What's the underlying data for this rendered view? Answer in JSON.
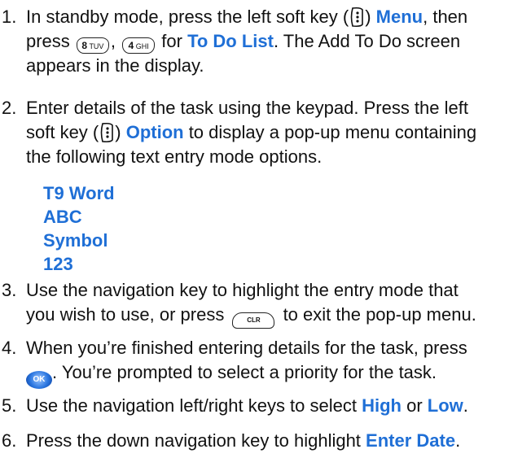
{
  "steps": [
    {
      "n": "1.",
      "l1": {
        "a": "In standby mode, press the left soft key (",
        "b": ") ",
        "menu": "Menu",
        "c": ", then"
      },
      "l2": {
        "a": "press ",
        "sep": ", ",
        "b": " for ",
        "todo": "To Do List",
        "c": ". The Add To Do screen"
      },
      "l3": "appears in the display."
    },
    {
      "n": "2.",
      "l1": "Enter details of the task using the keypad. Press the left",
      "l2": {
        "a": "soft key (",
        "b": ") ",
        "option": "Option",
        "c": " to display a pop-up menu containing"
      },
      "l3": "the following text entry mode options."
    },
    {
      "n": "3.",
      "l1": "Use the navigation key to highlight the entry mode that",
      "l2": {
        "a": "you wish to use, or press ",
        "b": " to exit the pop-up menu."
      }
    },
    {
      "n": "4.",
      "l1": "When you’re finished entering details for the task, press",
      "l2": ". You’re prompted to select a priority for the task."
    },
    {
      "n": "5.",
      "l1": {
        "a": "Use the navigation left/right keys to select ",
        "high": "High",
        "or": " or ",
        "low": "Low",
        "c": "."
      }
    },
    {
      "n": "6.",
      "l1": {
        "a": "Press the down navigation key to highlight ",
        "date": "Enter Date",
        "c": "."
      }
    }
  ],
  "options": [
    "T9 Word",
    "ABC",
    "Symbol",
    "123"
  ],
  "keys": {
    "k8": {
      "digit": "8",
      "letters": "TUV"
    },
    "k4": {
      "digit": "4",
      "letters": "GHI"
    },
    "clr": "CLR",
    "ok": "OK"
  },
  "colors": {
    "highlight": "#1f6fd6",
    "text": "#111111"
  }
}
